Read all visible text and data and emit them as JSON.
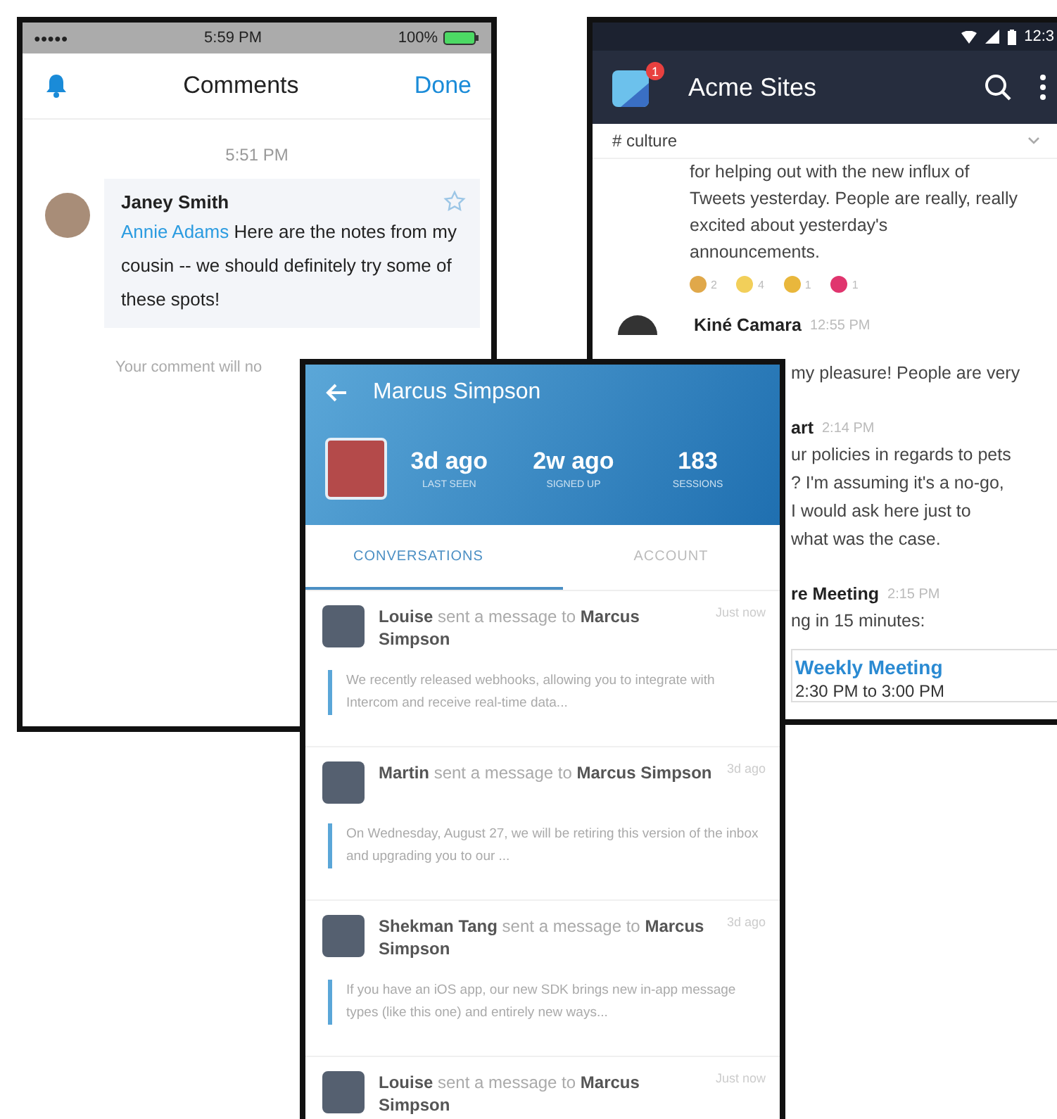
{
  "comments_screen": {
    "status_bar": {
      "signal": "●●●●●",
      "time": "5:59 PM",
      "battery": "100%"
    },
    "title": "Comments",
    "done": "Done",
    "timestamp": "5:51 PM",
    "comments": [
      {
        "author": "Janey Smith",
        "mention": "Annie Adams",
        "text": "Here are the notes from my cousin -- we should definitely try some of these spots!",
        "starred": false
      }
    ],
    "input": {
      "placeholder": "Your comment will no"
    }
  },
  "chat_screen": {
    "status_bar": {
      "time": "12:3"
    },
    "app_bar": {
      "title": "Acme Sites",
      "badge": "1"
    },
    "channel": "# culture",
    "messages": [
      {
        "kind": "continuation",
        "lines": [
          "for helping out with the new influx of",
          "Tweets yesterday. People are really, really",
          "excited about yesterday's",
          "announcements."
        ],
        "reactions": [
          {
            "count": "2",
            "color": "#e0a84a"
          },
          {
            "count": "4",
            "color": "#f2cf5a"
          },
          {
            "count": "1",
            "color": "#e9b73c"
          },
          {
            "count": "1",
            "color": "#e0356e"
          }
        ]
      },
      {
        "kind": "message",
        "author": "Kiné Camara",
        "time": "12:55 PM",
        "lines": [
          "my pleasure! People are very"
        ]
      },
      {
        "kind": "cropped",
        "author": "art",
        "time": "2:14 PM",
        "lines": [
          "ur policies in regards to pets",
          "? I'm assuming it's a no-go,",
          "I would ask here just to",
          "what was the case."
        ]
      },
      {
        "kind": "cropped",
        "author": "re Meeting",
        "time": "2:15 PM",
        "lines": [
          "ng in 15 minutes:"
        ],
        "event": {
          "title": "Weekly Meeting",
          "time": "2:30 PM to 3:00 PM"
        }
      }
    ]
  },
  "profile_screen": {
    "title": "Marcus Simpson",
    "stats": [
      {
        "value": "3d ago",
        "label": "LAST SEEN"
      },
      {
        "value": "2w ago",
        "label": "SIGNED UP"
      },
      {
        "value": "183",
        "label": "SESSIONS"
      }
    ],
    "tabs": [
      {
        "label": "CONVERSATIONS",
        "selected": true
      },
      {
        "label": "ACCOUNT",
        "selected": false
      }
    ],
    "conversations": [
      {
        "summary": "**Louise** sent a message to **Marcus Simpson**",
        "time": "Just now",
        "preview": "We recently released webhooks, allowing you to integrate with Intercom and receive real-time data..."
      },
      {
        "summary": "**Martin** sent a message to **Marcus Simpson**",
        "time": "3d ago",
        "preview": "On Wednesday, August 27, we will be retiring this version of the inbox and upgrading you to our ..."
      },
      {
        "summary": "**Shekman Tang** sent a message to **Marcus Simpson**",
        "time": "3d ago",
        "preview": "If you have an iOS app, our new SDK brings new in-app message types (like this one) and entirely new ways..."
      },
      {
        "summary": "**Louise** sent a message to **Marcus Simpson**",
        "time": "Just now"
      }
    ]
  }
}
